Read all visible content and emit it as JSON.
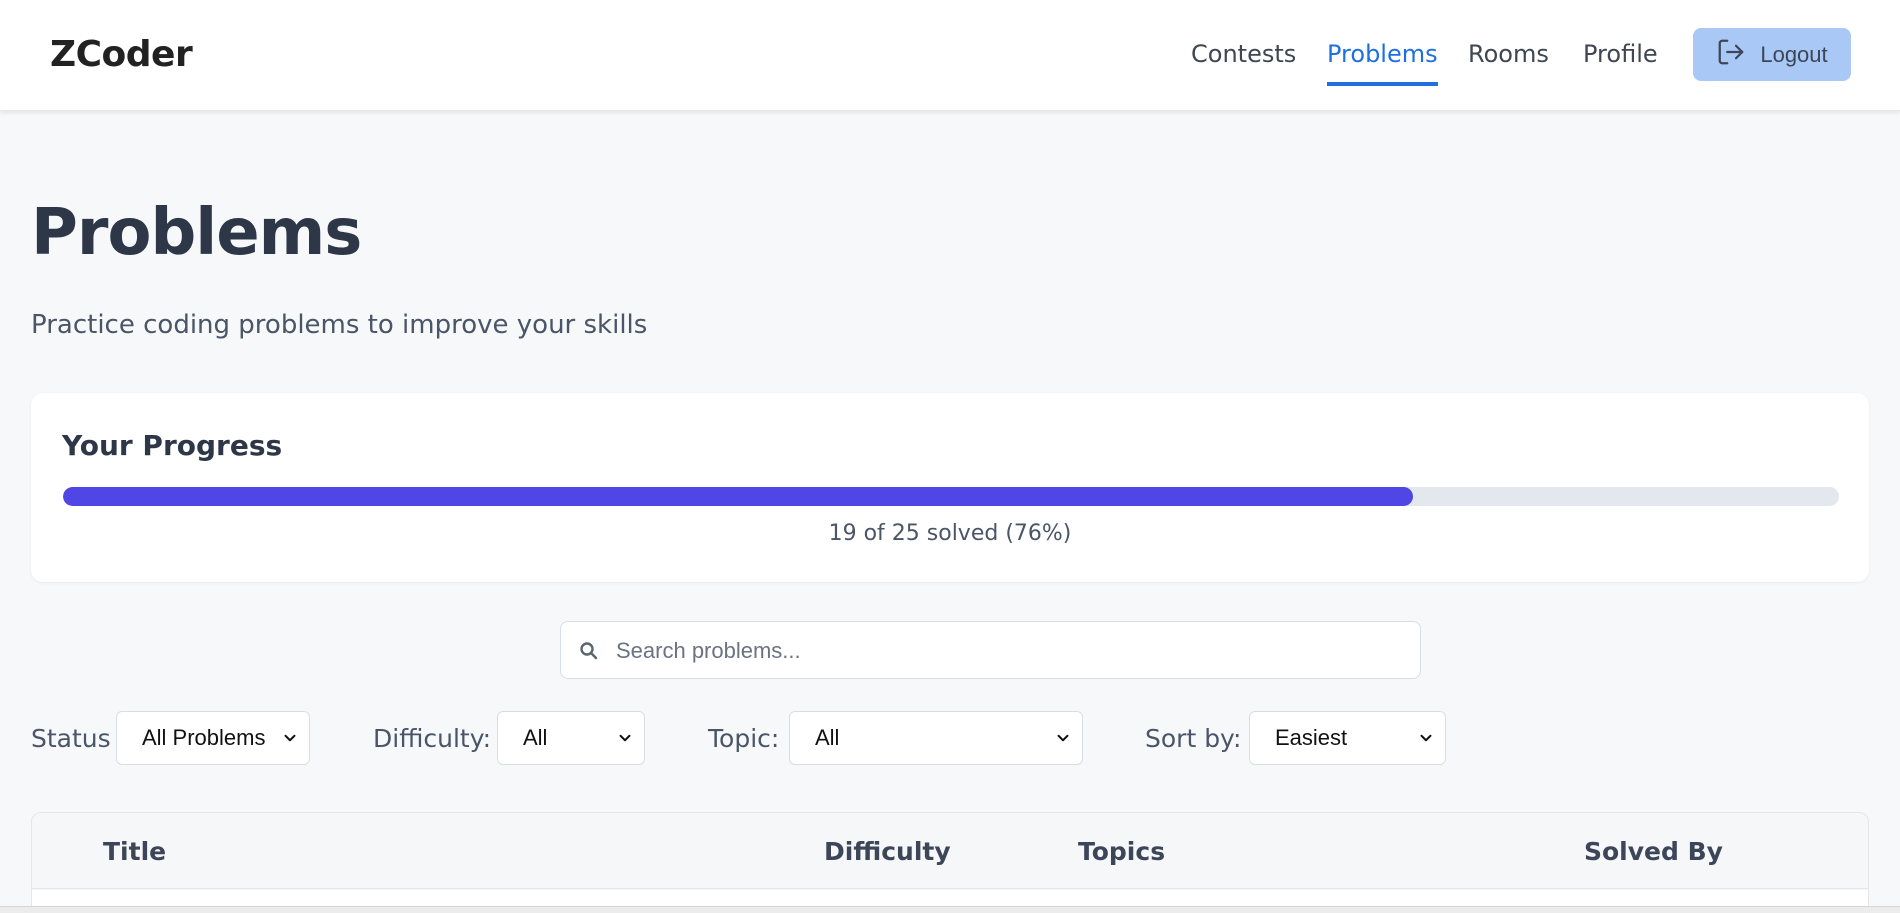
{
  "nav": {
    "brand": "ZCoder",
    "links": [
      {
        "label": "Contests"
      },
      {
        "label": "Problems"
      },
      {
        "label": "Rooms"
      },
      {
        "label": "Profile"
      }
    ],
    "active": "Problems",
    "logout_label": "Logout",
    "logout_icon": "logout-icon",
    "accent_color": "#1f6fe0"
  },
  "page": {
    "title": "Problems",
    "subtitle": "Practice coding problems to improve your skills"
  },
  "progress": {
    "title": "Your Progress",
    "solved": 19,
    "total": 25,
    "fraction": 0.76,
    "text": "19 of 25 solved (76%)",
    "bar_color": "#4f46e5"
  },
  "search": {
    "placeholder": "Search problems...",
    "value": "",
    "icon": "search-icon"
  },
  "filters": {
    "status": {
      "label": "Status",
      "value": "All Problems"
    },
    "difficulty": {
      "label": "Difficulty:",
      "value": "All"
    },
    "topic": {
      "label": "Topic:",
      "value": "All"
    },
    "sort": {
      "label": "Sort by:",
      "value": "Easiest"
    }
  },
  "table": {
    "columns": [
      "Title",
      "Difficulty",
      "Topics",
      "Solved By"
    ]
  }
}
